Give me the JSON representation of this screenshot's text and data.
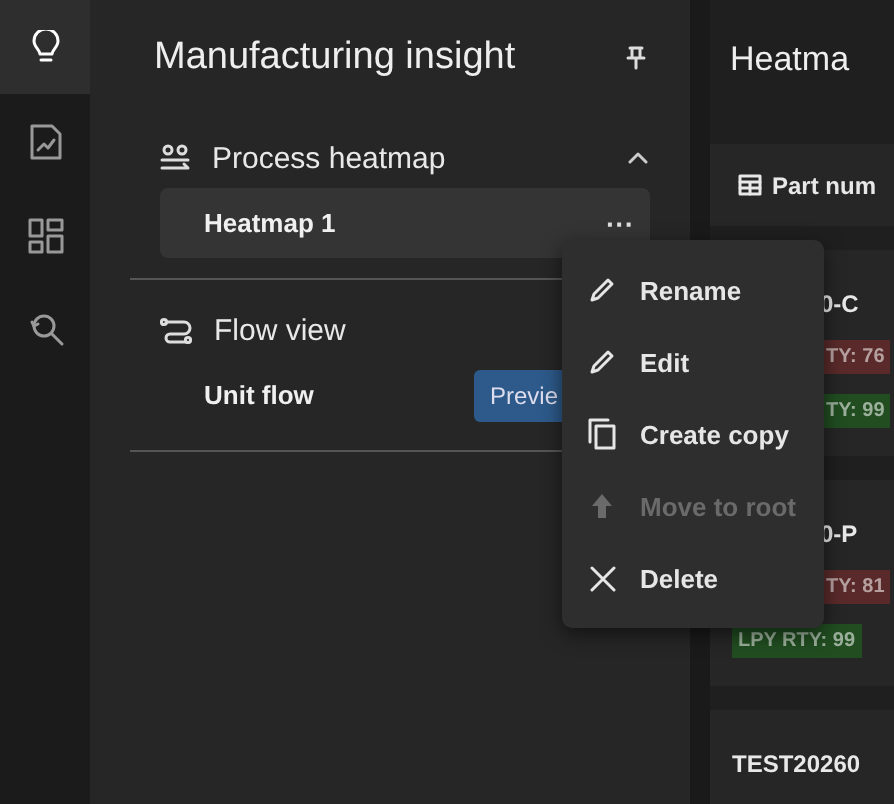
{
  "rail": [
    {
      "kind": "bulb",
      "selected": true
    },
    {
      "kind": "chart",
      "selected": false
    },
    {
      "kind": "dashboard",
      "selected": false
    },
    {
      "kind": "search",
      "selected": false
    }
  ],
  "sidebar": {
    "title": "Manufacturing insight",
    "sections": [
      {
        "kind": "heatmap",
        "label": "Process heatmap",
        "expanded": true,
        "items": [
          {
            "label": "Heatmap 1",
            "selected": true,
            "more": "···"
          }
        ]
      },
      {
        "kind": "flow",
        "label": "Flow view",
        "items": [
          {
            "label": "Unit flow",
            "selected": false,
            "button": "Previe"
          }
        ]
      }
    ]
  },
  "main": {
    "title": "Heatma",
    "filter": "Part num",
    "cards": [
      {
        "title": "0-C",
        "badges": [
          {
            "text": "TY: 76",
            "color": "#5a2a2a"
          },
          {
            "text": "TY: 99",
            "color": "#214d21"
          }
        ]
      },
      {
        "title": "0-P",
        "badges": [
          {
            "text": "TY: 81",
            "color": "#5a2a2a"
          },
          {
            "text": "LPY RTY: 99",
            "color": "#214d21"
          }
        ]
      },
      {
        "title": "TEST20260"
      }
    ]
  },
  "menu": [
    {
      "kind": "rename",
      "label": "Rename",
      "disabled": false
    },
    {
      "kind": "edit",
      "label": "Edit",
      "disabled": false
    },
    {
      "kind": "copy",
      "label": "Create copy",
      "disabled": false
    },
    {
      "kind": "move",
      "label": "Move to root",
      "disabled": true
    },
    {
      "kind": "delete",
      "label": "Delete",
      "disabled": false
    }
  ]
}
